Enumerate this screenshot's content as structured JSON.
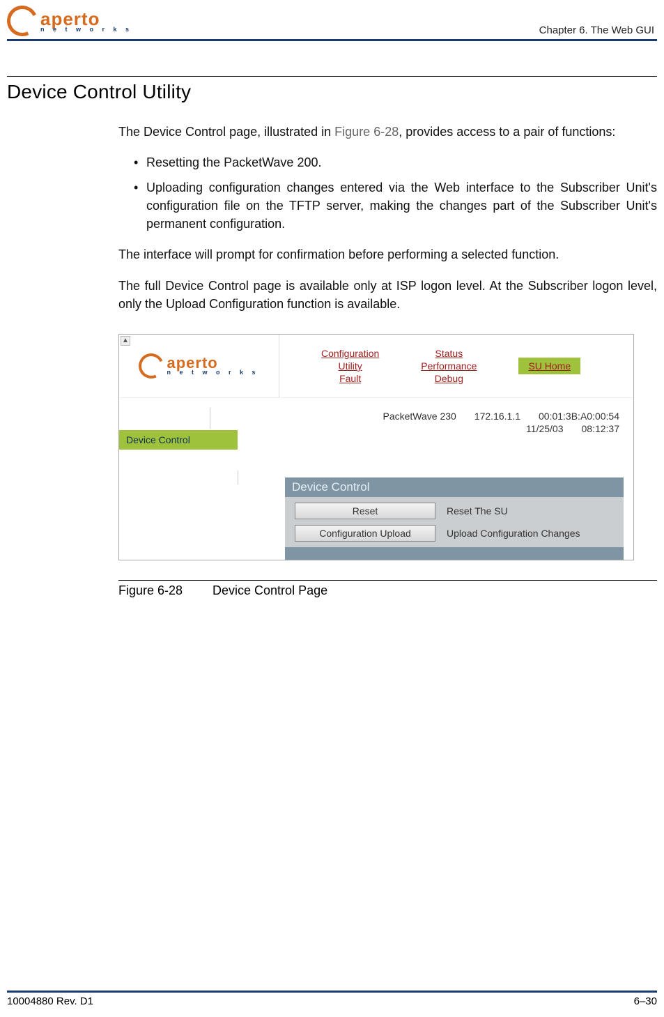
{
  "header": {
    "chapter_text": "Chapter 6.  The Web GUI"
  },
  "section": {
    "title": "Device Control Utility",
    "intro_before_link": "The Device Control page, illustrated in ",
    "intro_link": "Figure 6-28",
    "intro_after_link": ", provides access to a pair of functions:",
    "bullets": [
      "Resetting the PacketWave 200.",
      "Uploading configuration changes entered via the Web interface to the Subscriber Unit's configuration file on the TFTP server, making the changes part of the Subscriber Unit's permanent configuration."
    ],
    "para2": "The interface will prompt for confirmation before performing a selected function.",
    "para3": "The full Device Control page is available only at ISP logon level. At the Subscriber logon level, only the Upload Configuration function is available."
  },
  "screenshot": {
    "nav": {
      "col1": [
        "Configuration",
        "Utility",
        "Fault"
      ],
      "col2": [
        "Status",
        "Performance",
        "Debug"
      ],
      "su_home": "SU Home"
    },
    "info": {
      "device": "PacketWave 230",
      "ip": "172.16.1.1",
      "mac": "00:01:3B:A0:00:54",
      "date": "11/25/03",
      "time": "08:12:37"
    },
    "side_tab": "Device Control",
    "panel": {
      "title": "Device Control",
      "rows": [
        {
          "button": "Reset",
          "desc": "Reset The SU"
        },
        {
          "button": "Configuration Upload",
          "desc": "Upload Configuration Changes"
        }
      ]
    }
  },
  "figure_caption": {
    "number": "Figure 6-28",
    "title": "Device Control Page"
  },
  "footer": {
    "left": "10004880 Rev. D1",
    "right": "6–30"
  },
  "logo": {
    "brand": "aperto",
    "sub": "n e t w o r k s"
  }
}
